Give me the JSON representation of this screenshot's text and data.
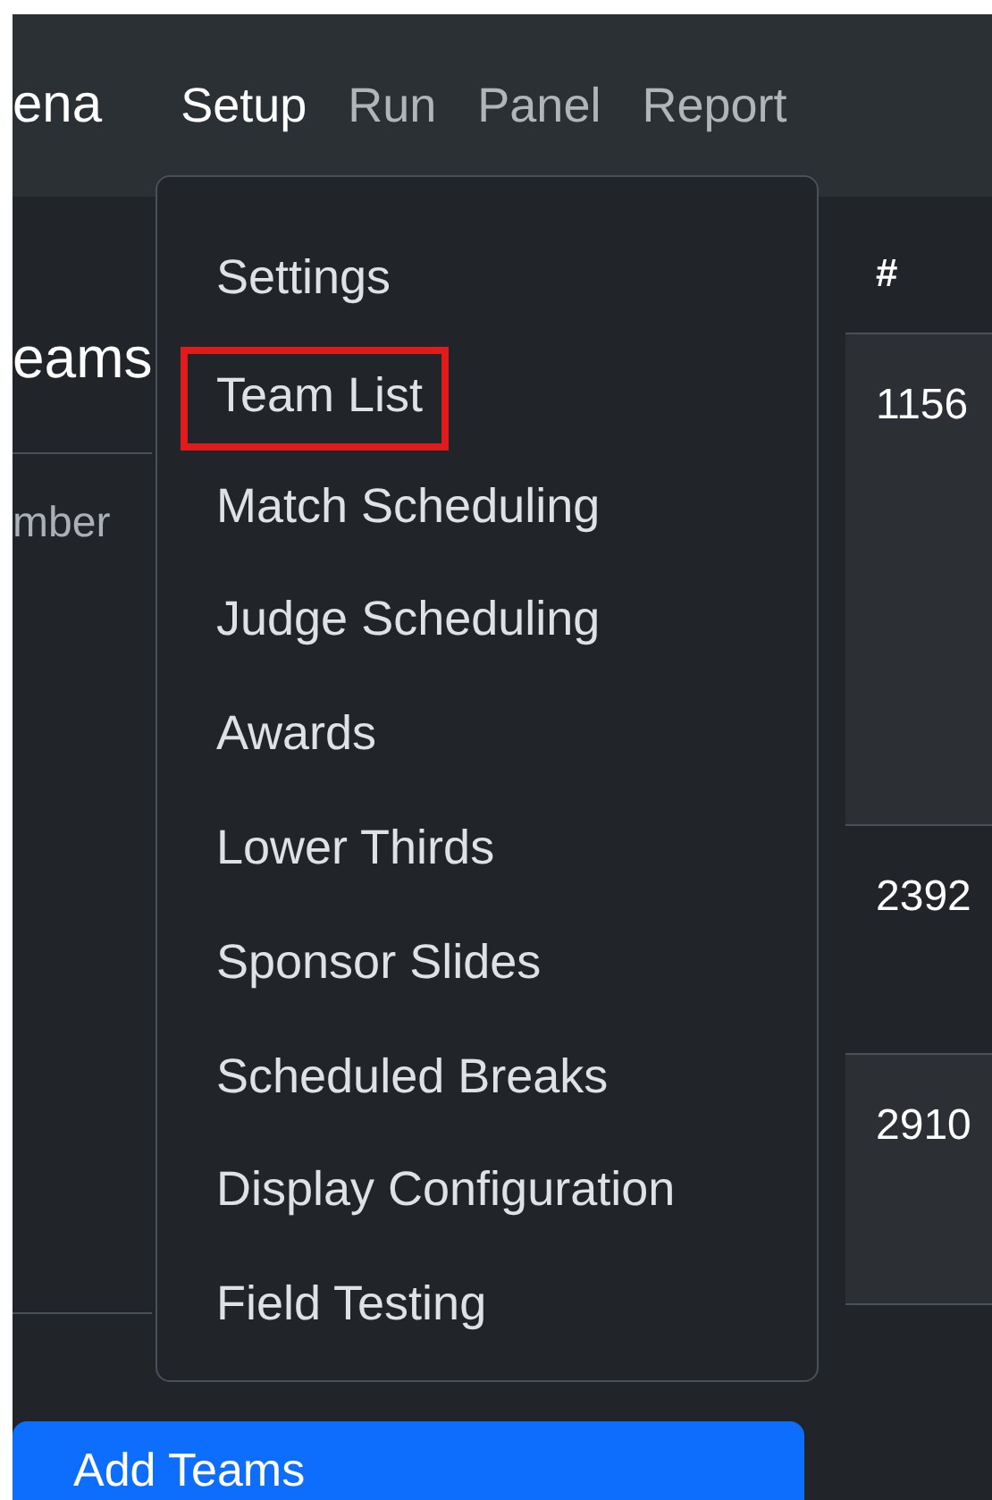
{
  "navbar": {
    "brand": "ena",
    "items": [
      {
        "label": "Setup",
        "selected": true
      },
      {
        "label": "Run",
        "selected": false
      },
      {
        "label": "Panel",
        "selected": false
      },
      {
        "label": "Report",
        "selected": false
      }
    ]
  },
  "sidebar": {
    "title": "eams",
    "hint": "mber",
    "button": "Add Teams"
  },
  "dropdown": {
    "items": [
      {
        "label": "Settings",
        "highlighted": false
      },
      {
        "label": "Team List",
        "highlighted": true
      },
      {
        "label": "Match Scheduling",
        "highlighted": false
      },
      {
        "label": "Judge Scheduling",
        "highlighted": false
      },
      {
        "label": "Awards",
        "highlighted": false
      },
      {
        "label": "Lower Thirds",
        "highlighted": false
      },
      {
        "label": "Sponsor Slides",
        "highlighted": false
      },
      {
        "label": "Scheduled Breaks",
        "highlighted": false
      },
      {
        "label": "Display Configuration",
        "highlighted": false
      },
      {
        "label": "Field Testing",
        "highlighted": false
      }
    ]
  },
  "table": {
    "header": "#",
    "rows": [
      "1156",
      "2392",
      "2910"
    ]
  }
}
